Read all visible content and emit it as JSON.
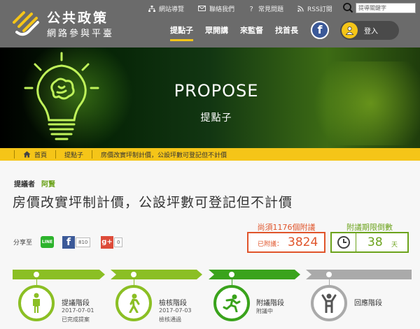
{
  "site": {
    "title": "公共政策",
    "subtitle": "網路參與平臺"
  },
  "util_links": [
    {
      "label": "網站導覽",
      "icon": "sitemap-icon"
    },
    {
      "label": "聯絡我們",
      "icon": "mail-icon"
    },
    {
      "label": "常見問題",
      "icon": "question-icon"
    },
    {
      "label": "RSS訂閱",
      "icon": "rss-icon"
    }
  ],
  "search": {
    "placeholder": "提導關鍵字"
  },
  "nav": [
    {
      "label": "提點子",
      "active": true
    },
    {
      "label": "眾開講",
      "active": false
    },
    {
      "label": "來監督",
      "active": false
    },
    {
      "label": "找首長",
      "active": false
    }
  ],
  "login": {
    "label": "登入"
  },
  "banner": {
    "title": "PROPOSE",
    "subtitle": "提點子"
  },
  "breadcrumb": [
    "首頁",
    "提點子",
    "房價改實坪制計價，公設坪數可登記但不計價"
  ],
  "proposal": {
    "proposer_label": "提議者",
    "proposer_name": "阿賢",
    "title": "房價改實坪制計價，公設坪數可登記但不計價"
  },
  "share": {
    "label": "分享至",
    "line_label": "LINE",
    "facebook_count": "810",
    "gplus_count": "0"
  },
  "endorse": {
    "needed_text": "尚須1176個附議",
    "count_label": "已附議：",
    "count": "3824"
  },
  "deadline": {
    "label": "附議期限倒數",
    "days": "38",
    "unit": "天"
  },
  "stages": [
    {
      "name": "提議階段",
      "date": "2017-07-01",
      "status": "已完成提案",
      "color": "#8bbf24",
      "icon": "person-standing-icon"
    },
    {
      "name": "檢核階段",
      "date": "2017-07-03",
      "status": "檢核通過",
      "color": "#8bbf24",
      "icon": "person-walking-icon"
    },
    {
      "name": "附議階段",
      "date": "",
      "status": "附議中",
      "color": "#3aa31c",
      "icon": "person-running-icon"
    },
    {
      "name": "回應階段",
      "date": "",
      "status": "",
      "color": "#aaaaaa",
      "icon": "person-arms-up-icon"
    }
  ],
  "colors": {
    "header_bg": "#6b6b6b",
    "accent_yellow": "#f5c518",
    "green": "#8bbf24",
    "orange": "#e0542a"
  }
}
